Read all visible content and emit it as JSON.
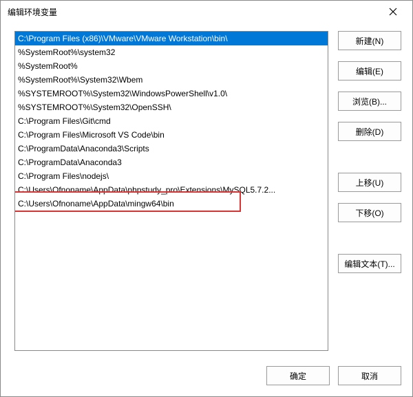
{
  "title": "编辑环境变量",
  "list": {
    "items": [
      "C:\\Program Files (x86)\\VMware\\VMware Workstation\\bin\\",
      "%SystemRoot%\\system32",
      "%SystemRoot%",
      "%SystemRoot%\\System32\\Wbem",
      "%SYSTEMROOT%\\System32\\WindowsPowerShell\\v1.0\\",
      "%SYSTEMROOT%\\System32\\OpenSSH\\",
      "C:\\Program Files\\Git\\cmd",
      "C:\\Program Files\\Microsoft VS Code\\bin",
      "C:\\ProgramData\\Anaconda3\\Scripts",
      "C:\\ProgramData\\Anaconda3",
      "C:\\Program Files\\nodejs\\",
      "C:\\Users\\Ofnoname\\AppData\\phpstudy_pro\\Extensions\\MySQL5.7.2...",
      "C:\\Users\\Ofnoname\\AppData\\mingw64\\bin"
    ],
    "selected_index": 0,
    "highlighted_index": 12
  },
  "buttons": {
    "new": "新建(N)",
    "edit": "编辑(E)",
    "browse": "浏览(B)...",
    "delete": "删除(D)",
    "move_up": "上移(U)",
    "move_down": "下移(O)",
    "edit_text": "编辑文本(T)...",
    "ok": "确定",
    "cancel": "取消"
  }
}
